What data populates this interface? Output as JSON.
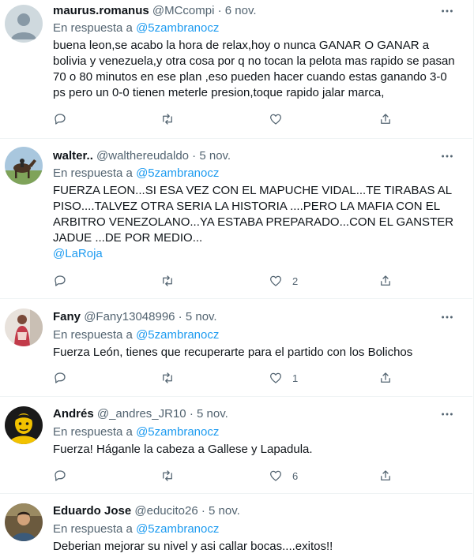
{
  "reply_prefix": "En respuesta a",
  "tweets": [
    {
      "name": "maurus.romanus",
      "handle": "@MCcompi",
      "dot": "·",
      "date": "6 nov.",
      "reply_to": "@5zambranocz",
      "lines": [
        "buena leon,se acabo la hora de relax,hoy o nunca GANAR O GANAR a",
        "bolivia y venezuela,y otra cosa por q no tocan la pelota mas rapido se pasan",
        "70 o 80 minutos en ese plan ,eso pueden hacer cuando estas ganando 3-0",
        "ps pero un 0-0 tienen meterle presion,toque rapido  jalar marca,"
      ],
      "mention_line": "",
      "likes": ""
    },
    {
      "name": "walter..",
      "handle": "@walthereudaldo",
      "dot": "·",
      "date": "5 nov.",
      "reply_to": "@5zambranocz",
      "lines": [
        "FUERZA LEON...SI ESA VEZ CON EL MAPUCHE VIDAL...TE TIRABAS AL",
        "PISO....TALVEZ OTRA SERIA LA HISTORIA ....PERO LA MAFIA CON EL",
        "ARBITRO VENEZOLANO...YA ESTABA PREPARADO...CON EL GANSTER",
        "JADUE ...DE POR MEDIO..."
      ],
      "mention_line": "@LaRoja",
      "likes": "2"
    },
    {
      "name": "Fany",
      "handle": "@Fany13048996",
      "dot": "·",
      "date": "5 nov.",
      "reply_to": "@5zambranocz",
      "lines": [
        "Fuerza León,  tienes que recuperarte para el partido con los Bolichos"
      ],
      "mention_line": "",
      "likes": "1"
    },
    {
      "name": "Andrés",
      "handle": "@_andres_JR10",
      "dot": "·",
      "date": "5 nov.",
      "reply_to": "@5zambranocz",
      "lines": [
        "Fuerza! Háganle la cabeza a Gallese y Lapadula."
      ],
      "mention_line": "",
      "likes": "6"
    },
    {
      "name": "Eduardo Jose",
      "handle": "@educito26",
      "dot": "·",
      "date": "5 nov.",
      "reply_to": "@5zambranocz",
      "lines": [
        "Deberian mejorar su nivel y asi callar bocas....exitos!!"
      ],
      "mention_line": "",
      "likes": ""
    }
  ],
  "colors": {
    "text": "#0f1419",
    "secondary": "#536471",
    "link": "#1d9bf0",
    "divider": "#eff3f4"
  },
  "icons": {
    "more": "more-options-icon",
    "reply": "reply-icon",
    "retweet": "retweet-icon",
    "like": "like-icon",
    "share": "share-icon"
  }
}
